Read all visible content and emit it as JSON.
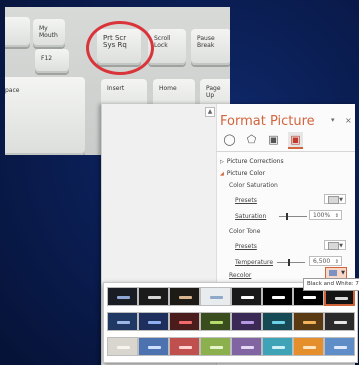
{
  "keyboard_photo": {
    "keys": [
      {
        "label": ""
      },
      {
        "label": "My Mouth"
      },
      {
        "label": "F12"
      },
      {
        "label": "Prt Scr\nSys Rq"
      },
      {
        "label": "Scroll\nLock"
      },
      {
        "label": "Pause\nBreak"
      },
      {
        "label": "pace"
      },
      {
        "label": "Insert"
      },
      {
        "label": "Home"
      },
      {
        "label": "Page\nUp"
      }
    ]
  },
  "format_picture": {
    "title": "Format Picture",
    "close_glyph": "×",
    "collapse_glyph": "▾",
    "tabs": [
      "fill-line",
      "effects",
      "size-properties",
      "picture"
    ],
    "picture_corrections": "Picture Corrections",
    "picture_color": "Picture Color",
    "color_saturation": {
      "heading": "Color Saturation",
      "presets_label": "Presets",
      "saturation_label": "Saturation",
      "saturation_value": "100%",
      "saturation_fraction": 0.25
    },
    "color_tone": {
      "heading": "Color Tone",
      "presets_label": "Presets",
      "temperature_label": "Temperature",
      "temperature_value": "6,500",
      "temperature_fraction": 0.4
    },
    "recolor_label": "Recolor"
  },
  "recolor_gallery": {
    "rows": [
      [
        {
          "bg": "#1a1d24",
          "bar": "#8ea7d6"
        },
        {
          "bg": "#1b1b1b",
          "bar": "#d6d6d6"
        },
        {
          "bg": "#1e1a16",
          "bar": "#d9b58f"
        },
        {
          "bg": "#e9ecef",
          "bar": "#8fa9c9"
        },
        {
          "bg": "#1a1a1a",
          "bar": "#ffffff"
        },
        {
          "bg": "#000000",
          "bar": "#ffffff"
        },
        {
          "bg": "#000000",
          "bar": "#ffffff"
        },
        {
          "bg": "#141414",
          "bar": "#dadada"
        }
      ],
      [
        {
          "bg": "#203864",
          "bar": "#9bb7e8"
        },
        {
          "bg": "#1e2f5e",
          "bar": "#8fb0f0"
        },
        {
          "bg": "#4a1c1c",
          "bar": "#f06a6a"
        },
        {
          "bg": "#3a4d1d",
          "bar": "#b5dc6a"
        },
        {
          "bg": "#3b2a55",
          "bar": "#b597e6"
        },
        {
          "bg": "#164a55",
          "bar": "#6ed2e6"
        },
        {
          "bg": "#5a3a12",
          "bar": "#f2b25a"
        },
        {
          "bg": "#2b2b2b",
          "bar": "#e6e6e6"
        }
      ],
      [
        {
          "bg": "#d9d6cf",
          "bar": "#f6f4ef"
        },
        {
          "bg": "#4c72b0",
          "bar": "#cfe0ff"
        },
        {
          "bg": "#c0504d",
          "bar": "#ffd3d2"
        },
        {
          "bg": "#8db04f",
          "bar": "#e6f4cc"
        },
        {
          "bg": "#8164a2",
          "bar": "#e3d7f3"
        },
        {
          "bg": "#3ea3b6",
          "bar": "#ccf0f6"
        },
        {
          "bg": "#e58f2c",
          "bar": "#ffe4c2"
        },
        {
          "bg": "#5f8dc7",
          "bar": "#dde9f8"
        }
      ]
    ],
    "tooltip": "Black and White: 75%"
  }
}
